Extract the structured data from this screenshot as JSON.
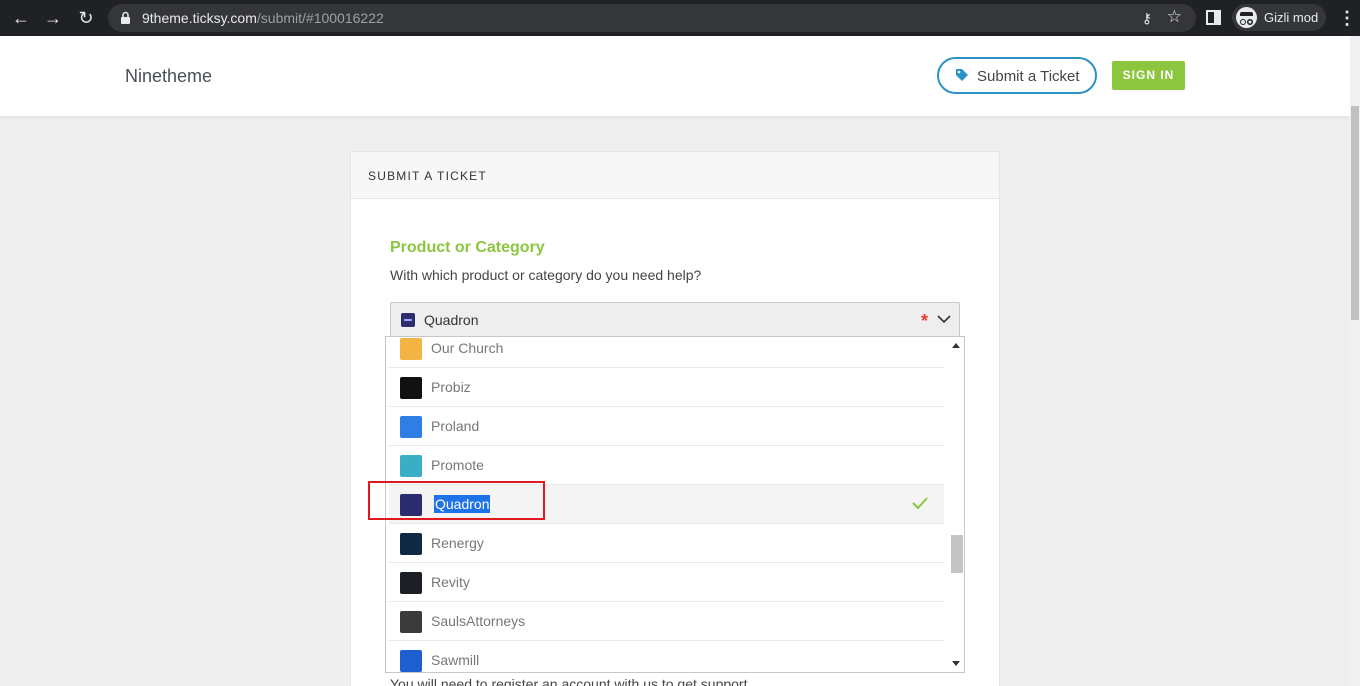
{
  "browser": {
    "url_host": "9theme.ticksy.com",
    "url_path": "/submit/#100016222",
    "profile_label": "Gizli mod"
  },
  "header": {
    "site_name": "Ninetheme",
    "submit_ticket_label": "Submit a Ticket",
    "sign_in_label": "SIGN IN"
  },
  "card": {
    "title": "SUBMIT A TICKET",
    "field_heading": "Product or Category",
    "field_description": "With which product or category do you need help?",
    "bottom_text": "You will need to register an account with us to get support."
  },
  "select": {
    "value": "Quadron",
    "required_mark": "*"
  },
  "dropdown": {
    "items": [
      {
        "label": "Our Church",
        "icon": "our-church-logo",
        "color": "#f3b444"
      },
      {
        "label": "Probiz",
        "icon": "probiz-logo",
        "color": "#111111"
      },
      {
        "label": "Proland",
        "icon": "proland-logo",
        "color": "#2f7ee6"
      },
      {
        "label": "Promote",
        "icon": "promote-logo",
        "color": "#3aaec5"
      },
      {
        "label": "Quadron",
        "icon": "quadron-logo",
        "color": "#2c2d6e",
        "selected": true
      },
      {
        "label": "Renergy",
        "icon": "renergy-logo",
        "color": "#0f2a44"
      },
      {
        "label": "Revity",
        "icon": "revity-logo",
        "color": "#1c1f24"
      },
      {
        "label": "SaulsAttorneys",
        "icon": "sauls-attorneys-logo",
        "color": "#3b3b3b"
      },
      {
        "label": "Sawmill",
        "icon": "sawmill-logo",
        "color": "#1d5fd1"
      }
    ]
  },
  "colors": {
    "accent_green": "#8cc63f",
    "accent_blue": "#2b93c3",
    "highlight_red": "#e0181f",
    "selection_blue": "#1e73e8"
  }
}
